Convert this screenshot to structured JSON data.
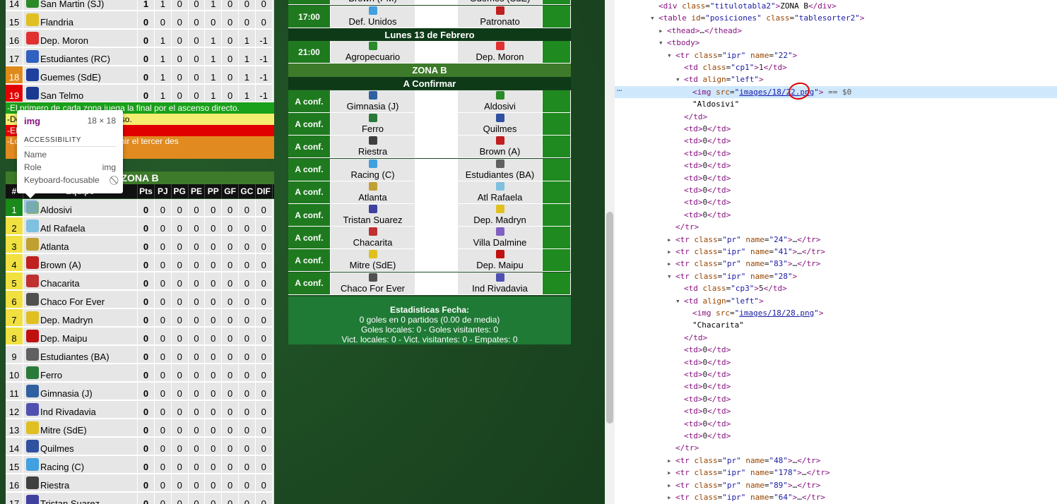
{
  "zona_a_tail": [
    {
      "pos": "14",
      "team": "San Martin (SJ)",
      "color": "#2a8a2a",
      "cls": "",
      "vals": [
        "1",
        "1",
        "0",
        "0",
        "1",
        "0",
        "0",
        "0"
      ]
    },
    {
      "pos": "15",
      "team": "Flandria",
      "color": "#e0c020",
      "cls": "",
      "vals": [
        "0",
        "0",
        "0",
        "0",
        "0",
        "0",
        "0",
        "0"
      ]
    },
    {
      "pos": "16",
      "team": "Dep. Moron",
      "color": "#e03030",
      "cls": "",
      "vals": [
        "0",
        "1",
        "0",
        "0",
        "1",
        "0",
        "1",
        "-1"
      ]
    },
    {
      "pos": "17",
      "team": "Estudiantes (RC)",
      "color": "#3060c0",
      "cls": "",
      "vals": [
        "0",
        "1",
        "0",
        "0",
        "1",
        "0",
        "1",
        "-1"
      ]
    },
    {
      "pos": "18",
      "team": "Guemes (SdE)",
      "color": "#2040a0",
      "cls": "pos-o",
      "vals": [
        "0",
        "1",
        "0",
        "0",
        "1",
        "0",
        "1",
        "-1"
      ]
    },
    {
      "pos": "19",
      "team": "San Telmo",
      "color": "#1a3a90",
      "cls": "pos-r",
      "vals": [
        "0",
        "1",
        "0",
        "0",
        "1",
        "0",
        "1",
        "-1"
      ]
    }
  ],
  "legend": {
    "green": "-El primero de cada zona juega la final por el ascenso directo.",
    "yellow": "-De                                              ado por el segundo ascenso.",
    "red": "-El                                               ende.",
    "orange": "-Lo                                               a juegan entre sí para definir el tercer des"
  },
  "zona_b": {
    "title": "ZONA B",
    "headers": [
      "#",
      "Equipo",
      "Pts",
      "PJ",
      "PG",
      "PE",
      "PP",
      "GF",
      "GC",
      "DIF"
    ],
    "rows": [
      {
        "pos": "1",
        "team": "Aldosivi",
        "color": "#7fb07f",
        "cls": "pos-g"
      },
      {
        "pos": "2",
        "team": "Atl Rafaela",
        "color": "#80c0e0",
        "cls": "pos-y"
      },
      {
        "pos": "3",
        "team": "Atlanta",
        "color": "#c0a030",
        "cls": "pos-y"
      },
      {
        "pos": "4",
        "team": "Brown (A)",
        "color": "#c02020",
        "cls": "pos-y"
      },
      {
        "pos": "5",
        "team": "Chacarita",
        "color": "#c03030",
        "cls": "pos-y"
      },
      {
        "pos": "6",
        "team": "Chaco For Ever",
        "color": "#505050",
        "cls": "pos-y"
      },
      {
        "pos": "7",
        "team": "Dep. Madryn",
        "color": "#e0c020",
        "cls": "pos-y"
      },
      {
        "pos": "8",
        "team": "Dep. Maipu",
        "color": "#c01010",
        "cls": "pos-y"
      },
      {
        "pos": "9",
        "team": "Estudiantes (BA)",
        "color": "#606060",
        "cls": ""
      },
      {
        "pos": "10",
        "team": "Ferro",
        "color": "#2a7a3a",
        "cls": ""
      },
      {
        "pos": "11",
        "team": "Gimnasia (J)",
        "color": "#3060a0",
        "cls": ""
      },
      {
        "pos": "12",
        "team": "Ind Rivadavia",
        "color": "#5050b0",
        "cls": ""
      },
      {
        "pos": "13",
        "team": "Mitre (SdE)",
        "color": "#e0c020",
        "cls": ""
      },
      {
        "pos": "14",
        "team": "Quilmes",
        "color": "#3050a0",
        "cls": ""
      },
      {
        "pos": "15",
        "team": "Racing (C)",
        "color": "#40a0e0",
        "cls": ""
      },
      {
        "pos": "16",
        "team": "Riestra",
        "color": "#404040",
        "cls": ""
      },
      {
        "pos": "17",
        "team": "Tristan Suarez",
        "color": "#4040a0",
        "cls": ""
      }
    ],
    "zero_vals": [
      "0",
      "0",
      "0",
      "0",
      "0",
      "0",
      "0",
      "0"
    ]
  },
  "tooltip": {
    "tag": "img",
    "size": "18 × 18",
    "section": "ACCESSIBILITY",
    "name_label": "Name",
    "role_label": "Role",
    "role_val": "img",
    "focus_label": "Keyboard-focusable",
    "focus_icon": "no-entry-icon"
  },
  "schedule": {
    "top_rows": [
      {
        "time": "",
        "home": "Brown (PM)",
        "away": "Guemes (SdE)",
        "hc": "#2a6a2a",
        "ac": "#2040a0"
      },
      {
        "time": "17:00",
        "home": "Def. Unidos",
        "away": "Patronato",
        "hc": "#40a0e0",
        "ac": "#c02020"
      }
    ],
    "day_header": "Lunes 13 de Febrero",
    "mon_rows": [
      {
        "time": "21:00",
        "home": "Agropecuario",
        "away": "Dep. Moron",
        "hc": "#2a8a2a",
        "ac": "#e03030"
      }
    ],
    "zone_header": "ZONA B",
    "confirm_header": "A Confirmar",
    "conf_rows": [
      {
        "time": "A conf.",
        "home": "Gimnasia (J)",
        "away": "Aldosivi",
        "hc": "#3060a0",
        "ac": "#2a8a2a"
      },
      {
        "time": "A conf.",
        "home": "Ferro",
        "away": "Quilmes",
        "hc": "#2a7a3a",
        "ac": "#3050a0"
      },
      {
        "time": "A conf.",
        "home": "Riestra",
        "away": "Brown (A)",
        "hc": "#404040",
        "ac": "#c02020"
      },
      {
        "time": "A conf.",
        "home": "Racing (C)",
        "away": "Estudiantes (BA)",
        "hc": "#40a0e0",
        "ac": "#606060"
      },
      {
        "time": "A conf.",
        "home": "Atlanta",
        "away": "Atl Rafaela",
        "hc": "#c0a030",
        "ac": "#80c0e0"
      },
      {
        "time": "A conf.",
        "home": "Tristan Suarez",
        "away": "Dep. Madryn",
        "hc": "#4040a0",
        "ac": "#e0c020"
      },
      {
        "time": "A conf.",
        "home": "Chacarita",
        "away": "Villa Dalmine",
        "hc": "#c03030",
        "ac": "#8060c0"
      },
      {
        "time": "A conf.",
        "home": "Mitre (SdE)",
        "away": "Dep. Maipu",
        "hc": "#e0c020",
        "ac": "#c01010"
      },
      {
        "time": "A conf.",
        "home": "Chaco For Ever",
        "away": "Ind Rivadavia",
        "hc": "#505050",
        "ac": "#5050b0"
      }
    ],
    "stats": {
      "title": "Estadisticas Fecha:",
      "line1": "0 goles en 0 partidos (0.00 de media)",
      "line2": "Goles locales: 0 - Goles visitantes: 0",
      "line3": "Vict. locales: 0 - Vict. visitantes: 0 - Empates: 0"
    }
  },
  "devtools": {
    "lines": [
      {
        "ind": 5,
        "arrow": "",
        "html": "<span class='tg'>&lt;div</span> <span class='at'>class</span>=<span class='av'>\"titulotabla2\"</span><span class='tg'>&gt;</span><span class='tx'>ZONA B</span><span class='tg'>&lt;/div&gt;</span>"
      },
      {
        "ind": 5,
        "arrow": "▼",
        "html": "<span class='tg'>&lt;table</span> <span class='at'>id</span>=<span class='av'>\"posiciones\"</span> <span class='at'>class</span>=<span class='av'>\"tablesorter2\"</span><span class='tg'>&gt;</span>"
      },
      {
        "ind": 6,
        "arrow": "▶",
        "html": "<span class='tg'>&lt;thead&gt;</span>…<span class='tg'>&lt;/thead&gt;</span>"
      },
      {
        "ind": 6,
        "arrow": "▼",
        "html": "<span class='tg'>&lt;tbody&gt;</span>"
      },
      {
        "ind": 7,
        "arrow": "▼",
        "html": "<span class='tg'>&lt;tr</span> <span class='at'>class</span>=<span class='av'>\"ipr\"</span> <span class='at'>name</span>=<span class='av'>\"22\"</span><span class='tg'>&gt;</span>"
      },
      {
        "ind": 8,
        "arrow": "",
        "html": "<span class='tg'>&lt;td</span> <span class='at'>class</span>=<span class='av'>\"cp1\"</span><span class='tg'>&gt;</span>1<span class='tg'>&lt;/td&gt;</span>"
      },
      {
        "ind": 8,
        "arrow": "▼",
        "html": "<span class='tg'>&lt;td</span> <span class='at'>align</span>=<span class='av'>\"left\"</span><span class='tg'>&gt;</span>"
      },
      {
        "ind": 9,
        "arrow": "",
        "sel": true,
        "html": "<span class='tg'>&lt;img</span> <span class='at'>src</span>=<span class='av'>\"<span class='lk'>images/18/22.png</span>\"</span><span class='tg'>&gt;</span> <span style='color:#555'>== $0</span>"
      },
      {
        "ind": 9,
        "arrow": "",
        "html": "<span class='tx'>\"Aldosivi\"</span>"
      },
      {
        "ind": 8,
        "arrow": "",
        "html": "<span class='tg'>&lt;/td&gt;</span>"
      },
      {
        "ind": 8,
        "arrow": "",
        "html": "<span class='tg'>&lt;td&gt;</span>0<span class='tg'>&lt;/td&gt;</span>"
      },
      {
        "ind": 8,
        "arrow": "",
        "html": "<span class='tg'>&lt;td&gt;</span>0<span class='tg'>&lt;/td&gt;</span>"
      },
      {
        "ind": 8,
        "arrow": "",
        "html": "<span class='tg'>&lt;td&gt;</span>0<span class='tg'>&lt;/td&gt;</span>"
      },
      {
        "ind": 8,
        "arrow": "",
        "html": "<span class='tg'>&lt;td&gt;</span>0<span class='tg'>&lt;/td&gt;</span>"
      },
      {
        "ind": 8,
        "arrow": "",
        "html": "<span class='tg'>&lt;td&gt;</span>0<span class='tg'>&lt;/td&gt;</span>"
      },
      {
        "ind": 8,
        "arrow": "",
        "html": "<span class='tg'>&lt;td&gt;</span>0<span class='tg'>&lt;/td&gt;</span>"
      },
      {
        "ind": 8,
        "arrow": "",
        "html": "<span class='tg'>&lt;td&gt;</span>0<span class='tg'>&lt;/td&gt;</span>"
      },
      {
        "ind": 8,
        "arrow": "",
        "html": "<span class='tg'>&lt;td&gt;</span>0<span class='tg'>&lt;/td&gt;</span>"
      },
      {
        "ind": 7,
        "arrow": "",
        "html": "<span class='tg'>&lt;/tr&gt;</span>"
      },
      {
        "ind": 7,
        "arrow": "▶",
        "html": "<span class='tg'>&lt;tr</span> <span class='at'>class</span>=<span class='av'>\"pr\"</span> <span class='at'>name</span>=<span class='av'>\"24\"</span><span class='tg'>&gt;</span>…<span class='tg'>&lt;/tr&gt;</span>"
      },
      {
        "ind": 7,
        "arrow": "▶",
        "html": "<span class='tg'>&lt;tr</span> <span class='at'>class</span>=<span class='av'>\"ipr\"</span> <span class='at'>name</span>=<span class='av'>\"41\"</span><span class='tg'>&gt;</span>…<span class='tg'>&lt;/tr&gt;</span>"
      },
      {
        "ind": 7,
        "arrow": "▶",
        "html": "<span class='tg'>&lt;tr</span> <span class='at'>class</span>=<span class='av'>\"pr\"</span> <span class='at'>name</span>=<span class='av'>\"83\"</span><span class='tg'>&gt;</span>…<span class='tg'>&lt;/tr&gt;</span>"
      },
      {
        "ind": 7,
        "arrow": "▼",
        "html": "<span class='tg'>&lt;tr</span> <span class='at'>class</span>=<span class='av'>\"ipr\"</span> <span class='at'>name</span>=<span class='av'>\"28\"</span><span class='tg'>&gt;</span>"
      },
      {
        "ind": 8,
        "arrow": "",
        "html": "<span class='tg'>&lt;td</span> <span class='at'>class</span>=<span class='av'>\"cp3\"</span><span class='tg'>&gt;</span>5<span class='tg'>&lt;/td&gt;</span>"
      },
      {
        "ind": 8,
        "arrow": "▼",
        "html": "<span class='tg'>&lt;td</span> <span class='at'>align</span>=<span class='av'>\"left\"</span><span class='tg'>&gt;</span>"
      },
      {
        "ind": 9,
        "arrow": "",
        "html": "<span class='tg'>&lt;img</span> <span class='at'>src</span>=<span class='av'>\"<span class='lk'>images/18/28.png</span>\"</span><span class='tg'>&gt;</span>"
      },
      {
        "ind": 9,
        "arrow": "",
        "html": "<span class='tx'>\"Chacarita\"</span>"
      },
      {
        "ind": 8,
        "arrow": "",
        "html": "<span class='tg'>&lt;/td&gt;</span>"
      },
      {
        "ind": 8,
        "arrow": "",
        "html": "<span class='tg'>&lt;td&gt;</span>0<span class='tg'>&lt;/td&gt;</span>"
      },
      {
        "ind": 8,
        "arrow": "",
        "html": "<span class='tg'>&lt;td&gt;</span>0<span class='tg'>&lt;/td&gt;</span>"
      },
      {
        "ind": 8,
        "arrow": "",
        "html": "<span class='tg'>&lt;td&gt;</span>0<span class='tg'>&lt;/td&gt;</span>"
      },
      {
        "ind": 8,
        "arrow": "",
        "html": "<span class='tg'>&lt;td&gt;</span>0<span class='tg'>&lt;/td&gt;</span>"
      },
      {
        "ind": 8,
        "arrow": "",
        "html": "<span class='tg'>&lt;td&gt;</span>0<span class='tg'>&lt;/td&gt;</span>"
      },
      {
        "ind": 8,
        "arrow": "",
        "html": "<span class='tg'>&lt;td&gt;</span>0<span class='tg'>&lt;/td&gt;</span>"
      },
      {
        "ind": 8,
        "arrow": "",
        "html": "<span class='tg'>&lt;td&gt;</span>0<span class='tg'>&lt;/td&gt;</span>"
      },
      {
        "ind": 8,
        "arrow": "",
        "html": "<span class='tg'>&lt;td&gt;</span>0<span class='tg'>&lt;/td&gt;</span>"
      },
      {
        "ind": 7,
        "arrow": "",
        "html": "<span class='tg'>&lt;/tr&gt;</span>"
      },
      {
        "ind": 7,
        "arrow": "▶",
        "html": "<span class='tg'>&lt;tr</span> <span class='at'>class</span>=<span class='av'>\"pr\"</span> <span class='at'>name</span>=<span class='av'>\"48\"</span><span class='tg'>&gt;</span>…<span class='tg'>&lt;/tr&gt;</span>"
      },
      {
        "ind": 7,
        "arrow": "▶",
        "html": "<span class='tg'>&lt;tr</span> <span class='at'>class</span>=<span class='av'>\"ipr\"</span> <span class='at'>name</span>=<span class='av'>\"178\"</span><span class='tg'>&gt;</span>…<span class='tg'>&lt;/tr&gt;</span>"
      },
      {
        "ind": 7,
        "arrow": "▶",
        "html": "<span class='tg'>&lt;tr</span> <span class='at'>class</span>=<span class='av'>\"pr\"</span> <span class='at'>name</span>=<span class='av'>\"89\"</span><span class='tg'>&gt;</span>…<span class='tg'>&lt;/tr&gt;</span>"
      },
      {
        "ind": 7,
        "arrow": "▶",
        "html": "<span class='tg'>&lt;tr</span> <span class='at'>class</span>=<span class='av'>\"ipr\"</span> <span class='at'>name</span>=<span class='av'>\"64\"</span><span class='tg'>&gt;</span>…<span class='tg'>&lt;/tr&gt;</span>"
      }
    ]
  }
}
